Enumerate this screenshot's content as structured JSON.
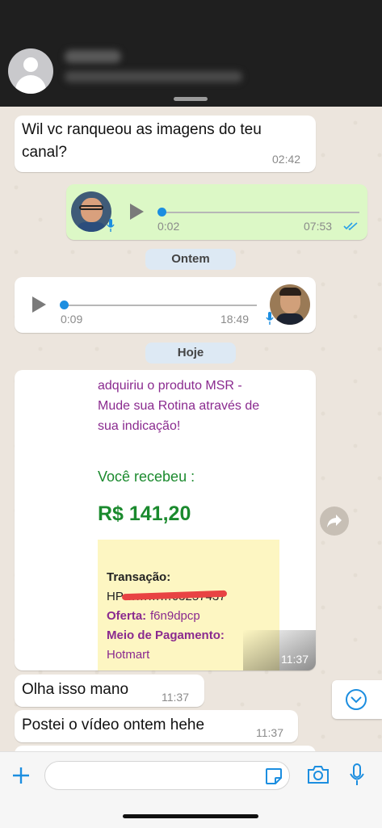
{
  "header": {},
  "messages": [
    {
      "text": "Wil vc ranqueou as imagens do teu canal?",
      "time": "02:42"
    },
    {
      "voice_elapsed": "0:02",
      "voice_duration": "07:53"
    },
    {
      "day": "Ontem"
    },
    {
      "voice_elapsed": "0:09",
      "voice_duration": "18:49"
    },
    {
      "day": "Hoje"
    },
    {
      "image_lines": [
        "adquiriu o produto MSR -",
        "Mude sua Rotina através de",
        "sua indicação!"
      ],
      "received_label": "Você recebeu :",
      "amount": "R$ 141,20",
      "transacao_label": "Transação:",
      "transacao_value": "HP…………03257437",
      "oferta_label": "Oferta:",
      "oferta_value": "f6n9dpcp",
      "meio_label": "Meio de Pagamento:",
      "meio_value": "Hotmart",
      "time": "11:37"
    },
    {
      "text": "Olha isso mano",
      "time": "11:37"
    },
    {
      "text": "Postei o vídeo ontem hehe",
      "time": "11:37"
    }
  ],
  "colors": {
    "outgoing": "#dcf8c6",
    "accent": "#1c8ee0",
    "purple": "#8a2a8f",
    "green": "#1b8a2e"
  },
  "icons": [
    "plus-icon",
    "sticker-icon",
    "camera-icon",
    "mic-icon",
    "forward-icon",
    "chevron-down-icon"
  ]
}
